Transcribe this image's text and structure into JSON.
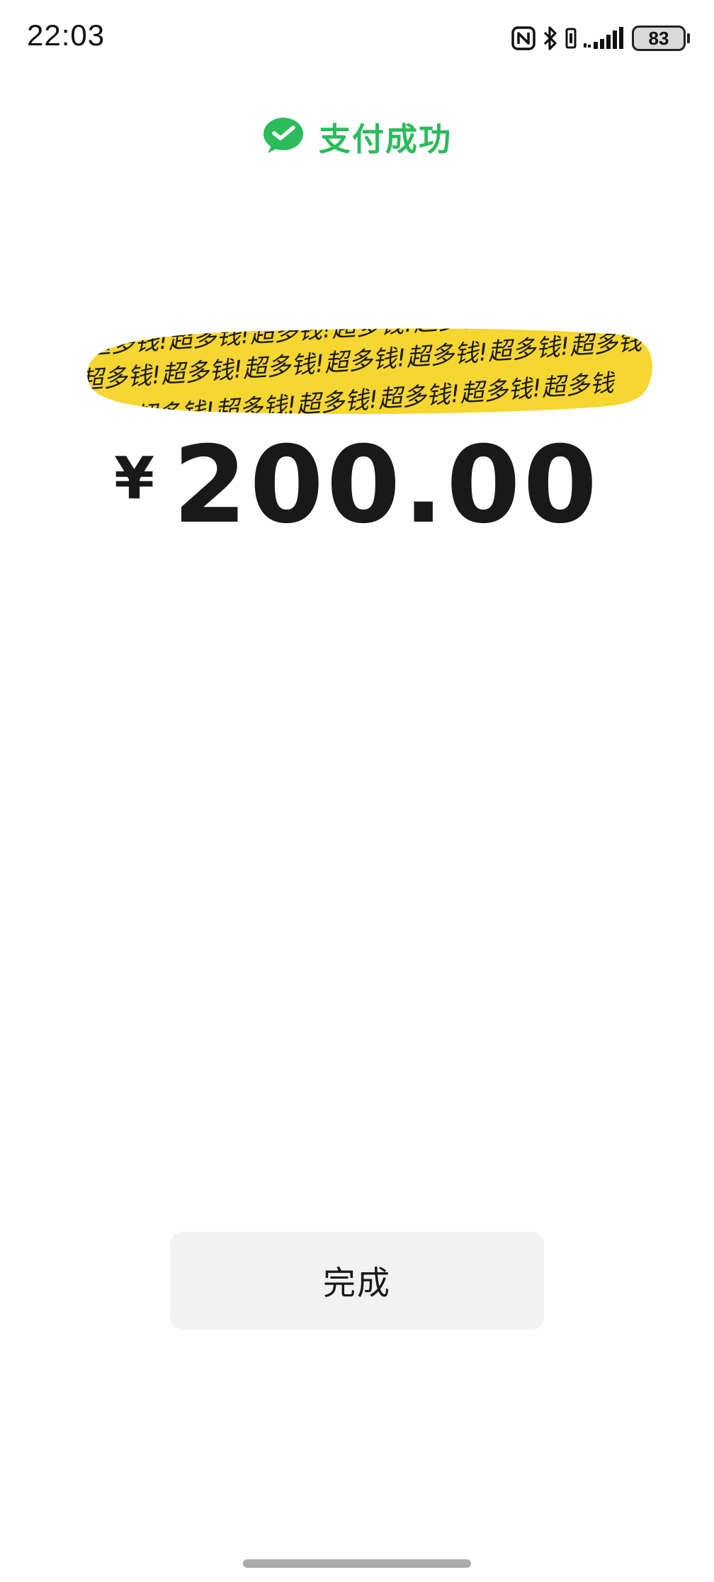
{
  "status_bar": {
    "time": "22:03",
    "battery_level": "83",
    "icons": [
      "nfc-icon",
      "bluetooth-icon",
      "vibrate-icon",
      "signal-icon",
      "battery-icon"
    ]
  },
  "header": {
    "icon": "wechat-pay-check-icon",
    "title": "支付成功"
  },
  "payment": {
    "currency_symbol": "¥",
    "amount": "200.00",
    "decoration_text": "!超多钱"
  },
  "actions": {
    "done_label": "完成"
  },
  "colors": {
    "brand_green": "#2cbb5c",
    "highlight_yellow": "#f6d630",
    "text_dark": "#191919",
    "button_bg": "#f2f2f2"
  }
}
